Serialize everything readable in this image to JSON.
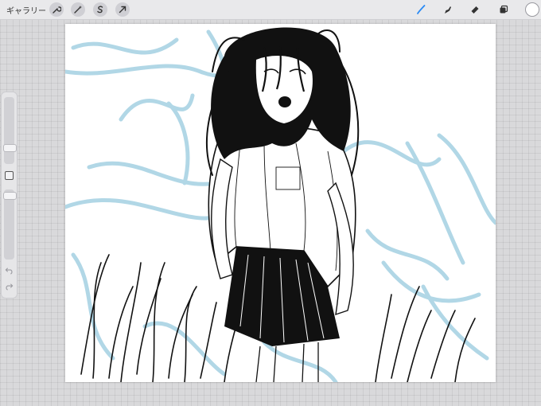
{
  "topbar": {
    "gallery_label": "ギャラリー",
    "left_tools": [
      {
        "name": "wrench-icon"
      },
      {
        "name": "magic-wand-icon"
      },
      {
        "name": "selection-s-icon"
      },
      {
        "name": "arrow-transform-icon"
      }
    ],
    "right_tools": [
      {
        "name": "brush-icon",
        "active": true
      },
      {
        "name": "smudge-icon"
      },
      {
        "name": "eraser-icon"
      },
      {
        "name": "layers-icon"
      }
    ],
    "color_well": "#ffffff"
  },
  "sidebar": {
    "undo_icon": "undo-icon",
    "redo_icon": "redo-icon",
    "brush_size": 0.82,
    "opacity": 0.97
  },
  "colors": {
    "active_tool": "#2b8bf5",
    "sketch_blue": "#a9d3e4",
    "ink": "#111111"
  }
}
